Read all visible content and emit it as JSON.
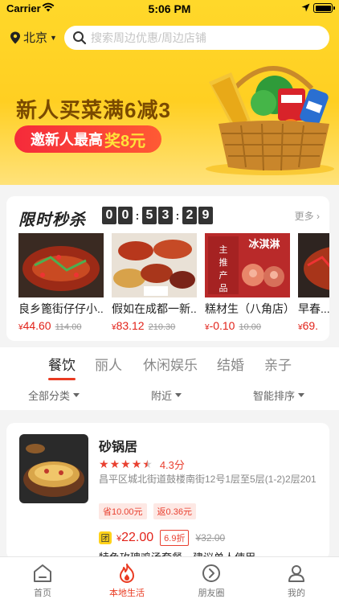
{
  "status_bar": {
    "carrier": "Carrier",
    "time": "5:06 PM"
  },
  "header": {
    "city": "北京",
    "search_placeholder": "搜索周边优惠/周边店铺"
  },
  "banner": {
    "headline": "新人买菜满6减3",
    "pill_text": "邀新人最高",
    "pill_highlight": "奖8元"
  },
  "flash_sale": {
    "title": "限时秒杀",
    "countdown": [
      "0",
      "0",
      "5",
      "3",
      "2",
      "9"
    ],
    "more": "更多",
    "items": [
      {
        "name": "良乡篦街仔仔小...",
        "currency": "¥",
        "price": "44.60",
        "old": "114.00"
      },
      {
        "name": "假如在成都一新...",
        "currency": "¥",
        "price": "83.12",
        "old": "210.30"
      },
      {
        "name": "糕材生（八角店）",
        "currency": "¥",
        "price": "-0.10",
        "old": "10.00"
      },
      {
        "name": "早春...",
        "currency": "¥",
        "price": "69.",
        "old": ""
      }
    ]
  },
  "category_tabs": [
    "餐饮",
    "丽人",
    "休闲娱乐",
    "结婚",
    "亲子"
  ],
  "filters": [
    "全部分类",
    "附近",
    "智能排序"
  ],
  "shop": {
    "name": "砂锅居",
    "rating": 4.5,
    "score_text": "4.3分",
    "address": "昌平区城北街道鼓楼南街12号1层至5层(1-2)2层201",
    "tags": [
      "省10.00元",
      "返0.36元"
    ],
    "group_badge": "团",
    "group_currency": "¥",
    "group_price": "22.00",
    "discount": "6.9折",
    "group_old": "¥32.00",
    "deal_desc": "特色玫瑰鸡汤套餐，建议单人使用"
  },
  "tabbar": [
    {
      "label": "首页",
      "icon": "home-icon"
    },
    {
      "label": "本地生活",
      "icon": "flame-icon"
    },
    {
      "label": "朋友圈",
      "icon": "friends-circle-icon"
    },
    {
      "label": "我的",
      "icon": "profile-icon"
    }
  ],
  "colors": {
    "accent": "#e93b22",
    "yellow": "#ffd21a",
    "price_red": "#e2231a"
  }
}
